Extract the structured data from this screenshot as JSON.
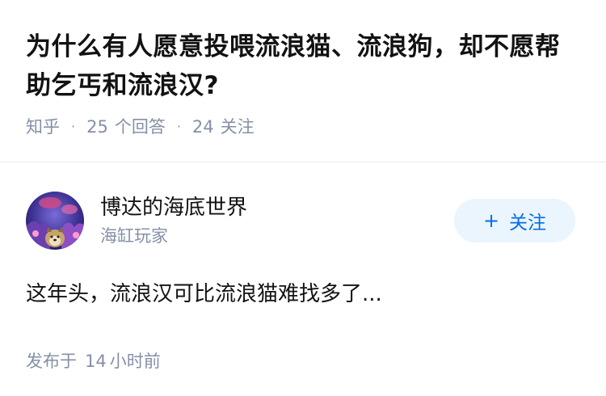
{
  "question": {
    "title": "为什么有人愿意投喂流浪猫、流浪狗，却不愿帮助乞丐和流浪汉?",
    "source": "知乎",
    "answers_count": "25",
    "answers_label": "个回答",
    "followers_count": "24",
    "followers_label": "关注"
  },
  "answer": {
    "author_name": "博达的海底世界",
    "author_bio": "海缸玩家",
    "follow_label": "关注",
    "excerpt": "这年头，流浪汉可比流浪猫难找多了...",
    "published_prefix": "发布于",
    "published_num": "14",
    "published_unit": "小时前"
  },
  "colors": {
    "meta_gray": "#8590a6",
    "accent_blue": "#056de8",
    "follow_bg": "#ebf5fd"
  },
  "icons": {
    "avatar": "aquarium-photo-with-dog-avatar",
    "follow": "plus-icon"
  }
}
